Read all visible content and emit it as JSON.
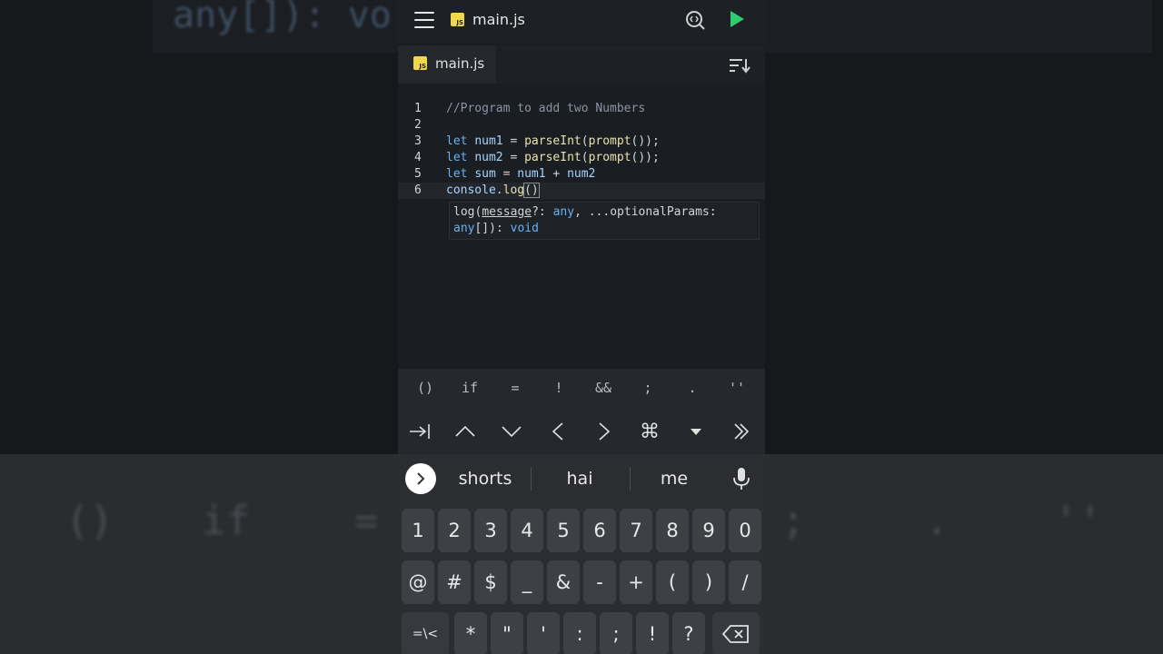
{
  "background": {
    "code_fragment": "any[]): vo",
    "sym_keys": [
      "()",
      "if",
      "=",
      ";",
      ".",
      "''"
    ]
  },
  "appbar": {
    "menu_icon": "hamburger-menu-icon",
    "file_badge": "JS",
    "title": "main.js",
    "find_icon": "code-search-icon",
    "run_icon": "play-icon"
  },
  "tabbar": {
    "tab_badge": "JS",
    "tab_label": "main.js",
    "sort_icon": "sort-icon"
  },
  "editor": {
    "line_numbers": [
      "1",
      "2",
      "3",
      "4",
      "5",
      "6"
    ],
    "lines": [
      {
        "comment": "//Program to add two Numbers"
      },
      {},
      {
        "kw": "let",
        "var": "num1",
        "op": " = ",
        "fn1": "parseInt",
        "p1": "(",
        "fn2": "prompt",
        "rest": "());"
      },
      {
        "kw": "let",
        "var": "num2",
        "op": " = ",
        "fn1": "parseInt",
        "p1": "(",
        "fn2": "prompt",
        "rest": "());"
      },
      {
        "kw": "let",
        "var": "sum",
        "op": " = ",
        "a": "num1",
        "plus": " + ",
        "b": "num2"
      },
      {
        "obj": "console",
        "dot": ".",
        "fn": "log",
        "args": "()"
      }
    ],
    "signature_hint": {
      "name": "log(",
      "param": "message",
      "rest1": "?: ",
      "type1": "any",
      "rest2": ", ...optionalParams:",
      "type2": "any",
      "rest3": "[]): ",
      "type3": "void"
    }
  },
  "symbol_bar": {
    "symbols": [
      "()",
      "if",
      "=",
      "!",
      "&&",
      ";",
      ".",
      "''"
    ],
    "nav_icons": [
      "tab-icon",
      "arrow-up-icon",
      "arrow-down-icon",
      "arrow-left-icon",
      "arrow-right-icon",
      "command-icon",
      "dropdown-icon",
      "double-chevron-right-icon"
    ],
    "nav_glyphs": [
      "⇥",
      "⌃",
      "⌄",
      "‹",
      "›",
      "⌘",
      "▾",
      "»"
    ]
  },
  "keyboard": {
    "suggestions": [
      "shorts",
      "hai",
      "me"
    ],
    "expand_icon": "chevron-right-icon",
    "mic_icon": "microphone-icon",
    "row1": [
      "1",
      "2",
      "3",
      "4",
      "5",
      "6",
      "7",
      "8",
      "9",
      "0"
    ],
    "row2": [
      "@",
      "#",
      "$",
      "_",
      "&",
      "-",
      "+",
      "(",
      ")",
      "/"
    ],
    "row3": [
      "=\\<",
      "*",
      "\"",
      "'",
      ":",
      ";",
      "!",
      "?"
    ],
    "backspace_icon": "backspace-icon"
  }
}
